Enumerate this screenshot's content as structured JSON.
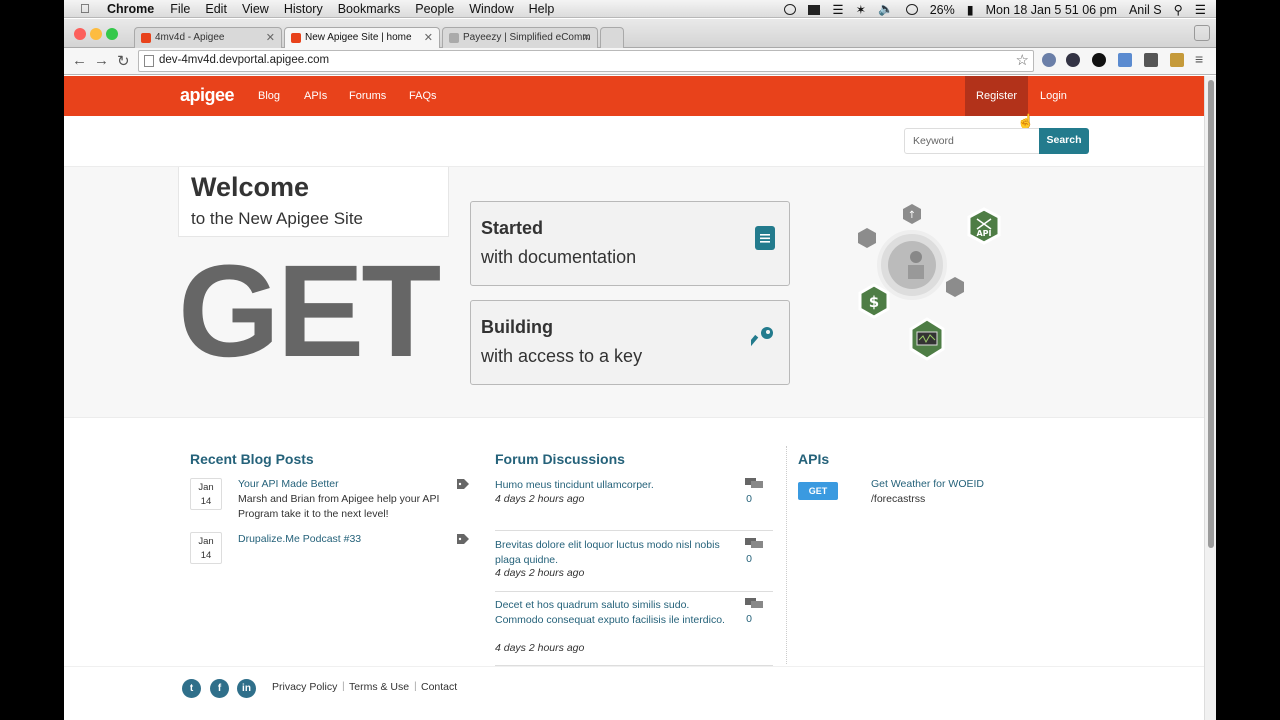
{
  "menubar": {
    "app": "Chrome",
    "menus": [
      "File",
      "Edit",
      "View",
      "History",
      "Bookmarks",
      "People",
      "Window",
      "Help"
    ],
    "battery": "26%",
    "datetime": "Mon 18 Jan  5 51 06 pm",
    "user": "Anil S"
  },
  "tabs": [
    {
      "label": "4mv4d - Apigee"
    },
    {
      "label": "New Apigee Site | home"
    },
    {
      "label": "Payeezy | Simplified eComm"
    }
  ],
  "address": "dev-4mv4d.devportal.apigee.com",
  "site": {
    "logo": "apigee",
    "nav": [
      "Blog",
      "APIs",
      "Forums",
      "FAQs"
    ],
    "register": "Register",
    "login": "Login",
    "search_placeholder": "Keyword",
    "search_button": "Search"
  },
  "hero": {
    "welcome": "Welcome",
    "welcome_sub": "to the New Apigee Site",
    "big_word": "GET",
    "cards": [
      {
        "title": "Started",
        "subtitle": "with documentation",
        "icon": "document-icon"
      },
      {
        "title": "Building",
        "subtitle": "with access to a key",
        "icon": "key-icon"
      }
    ],
    "graphic_badge": "API"
  },
  "blog": {
    "title": "Recent Blog Posts",
    "posts": [
      {
        "month": "Jan",
        "day": "14",
        "title": "Your API Made Better",
        "body": "Marsh and Brian from Apigee help your API Program take it to the next level!"
      },
      {
        "month": "Jan",
        "day": "14",
        "title": "Drupalize.Me Podcast #33",
        "body": ""
      }
    ]
  },
  "forum": {
    "title": "Forum Discussions",
    "items": [
      {
        "text": "Humo meus tincidunt ullamcorper.",
        "ago": "4 days 2 hours",
        "suffix": "ago",
        "count": "0"
      },
      {
        "text": "Brevitas dolore elit loquor luctus modo nisl nobis plaga quidne.",
        "ago": "4 days 2 hours",
        "suffix": "ago",
        "count": "0"
      },
      {
        "text": "Decet et hos quadrum saluto similis sudo. Commodo consequat exputo facilisis ile interdico.",
        "ago": "4 days 2 hours",
        "suffix": "ago",
        "count": ""
      }
    ]
  },
  "apis": {
    "title": "APIs",
    "items": [
      {
        "method": "GET",
        "name": "Get Weather for WOEID",
        "path": "/forecastrss"
      }
    ]
  },
  "footer": {
    "links": [
      "Privacy Policy",
      "Terms & Use",
      "Contact"
    ]
  },
  "colors": {
    "brand": "#e8421b",
    "accent": "#237b8d",
    "link": "#25627a"
  }
}
